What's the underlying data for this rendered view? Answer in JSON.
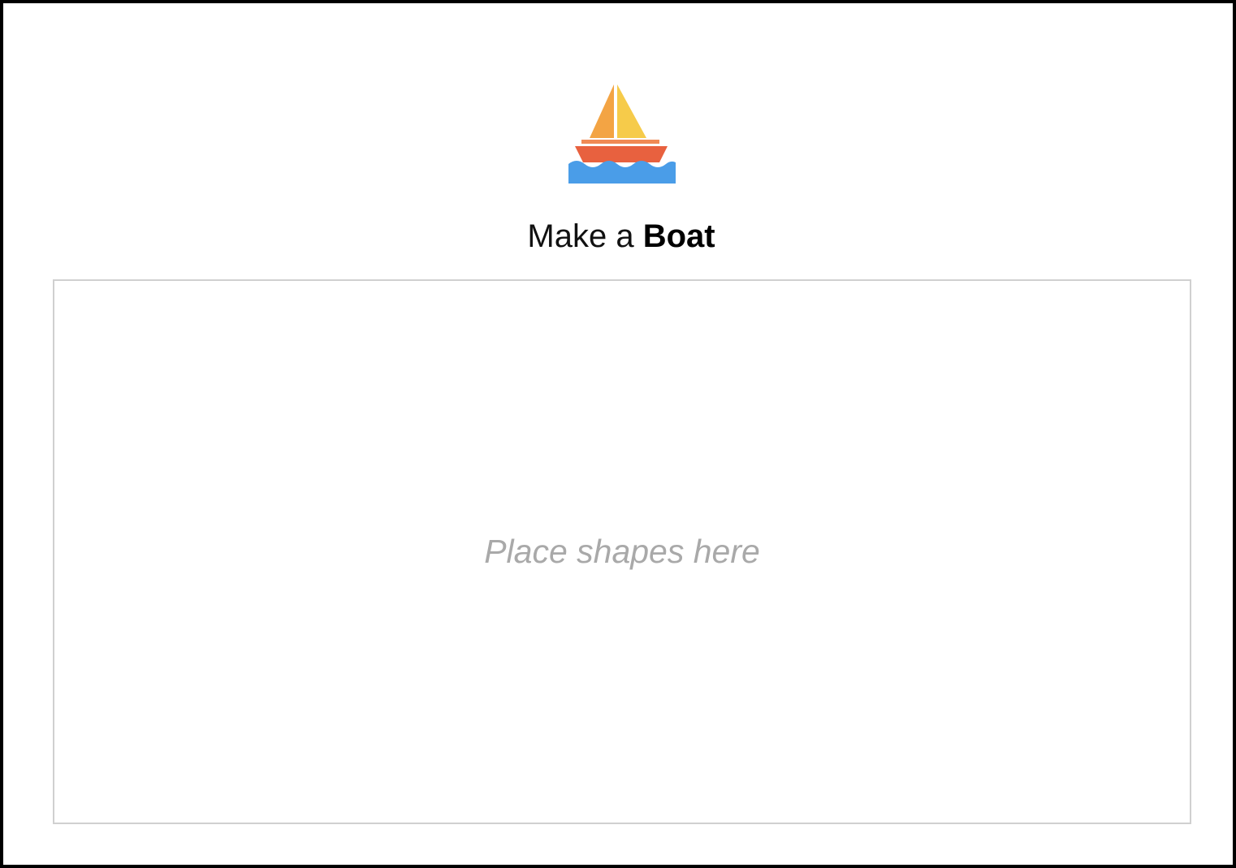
{
  "header": {
    "icon": "sailboat-icon",
    "title_prefix": "Make a ",
    "title_emphasis": "Boat"
  },
  "drop_zone": {
    "placeholder": "Place shapes here"
  },
  "colors": {
    "sail_left": "#f3a444",
    "sail_right": "#f6cb4a",
    "hull": "#e8613f",
    "water": "#4a9de8",
    "drop_zone_border": "#d0d0d0",
    "placeholder_text": "#a9a9a9"
  }
}
